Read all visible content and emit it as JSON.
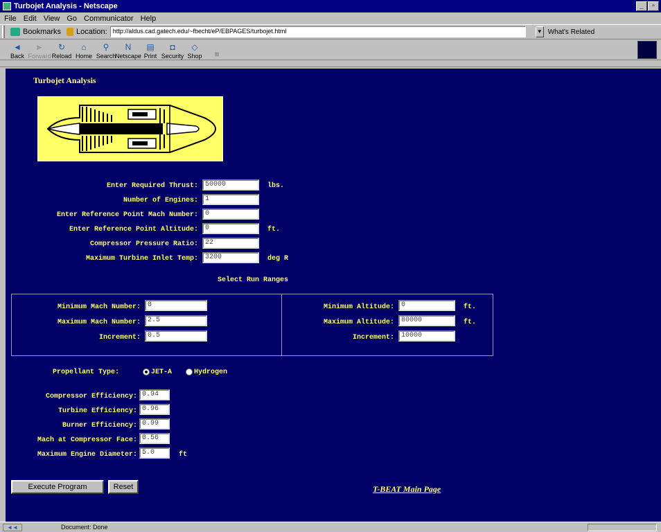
{
  "window": {
    "title": "Turbojet Analysis - Netscape"
  },
  "menu": [
    "File",
    "Edit",
    "View",
    "Go",
    "Communicator",
    "Help"
  ],
  "location_bar": {
    "bookmarks_label": "Bookmarks",
    "location_label": "Location:",
    "url": "http://aldus.cad.gatech.edu/~fbecht/eP/EBPAGES/turbojet.html",
    "related_label": "What's Related"
  },
  "toolbar": [
    {
      "label": "Back",
      "icon": "back-arrow-icon",
      "glyph": "◄"
    },
    {
      "label": "Forward",
      "icon": "forward-arrow-icon",
      "glyph": "►"
    },
    {
      "label": "Reload",
      "icon": "reload-icon",
      "glyph": "↻"
    },
    {
      "label": "Home",
      "icon": "home-icon",
      "glyph": "⌂"
    },
    {
      "label": "Search",
      "icon": "search-icon",
      "glyph": "⚲"
    },
    {
      "label": "Netscape",
      "icon": "netscape-icon",
      "glyph": "N"
    },
    {
      "label": "Print",
      "icon": "print-icon",
      "glyph": "▤"
    },
    {
      "label": "Security",
      "icon": "lock-icon",
      "glyph": "🔒"
    },
    {
      "label": "Shop",
      "icon": "shop-icon",
      "glyph": "◇"
    },
    {
      "label": "Stop",
      "icon": "stop-icon",
      "glyph": "■"
    }
  ],
  "page": {
    "heading": "Turbojet Analysis",
    "engine_image": "turbojet-engine-diagram",
    "inputs": {
      "thrust": {
        "label": "Enter Required Thrust:",
        "value": "50000",
        "unit": "lbs."
      },
      "engines": {
        "label": "Number of Engines:",
        "value": "1"
      },
      "ref_mach": {
        "label": "Enter Reference Point Mach Number:",
        "value": "0"
      },
      "ref_alt": {
        "label": "Enter Reference Point Altitude:",
        "value": "0",
        "unit": "ft."
      },
      "cpr": {
        "label": "Compressor Pressure Ratio:",
        "value": "22"
      },
      "tit": {
        "label": "Maximum Turbine Inlet Temp:",
        "value": "3200",
        "unit": "deg R"
      }
    },
    "ranges_heading": "Select Run Ranges",
    "ranges": {
      "min_mach": {
        "label": "Minimum Mach Number:",
        "value": "0"
      },
      "max_mach": {
        "label": "Maximum Mach Number:",
        "value": "2.5"
      },
      "mach_inc": {
        "label": "Increment:",
        "value": "0.5"
      },
      "min_alt": {
        "label": "Minimum Altitude:",
        "value": "0",
        "unit": "ft."
      },
      "max_alt": {
        "label": "Maximum Altitude:",
        "value": "80000",
        "unit": "ft."
      },
      "alt_inc": {
        "label": "Increment:",
        "value": "10000"
      }
    },
    "propellant": {
      "label": "Propellant Type:",
      "options": [
        "JET-A",
        "Hydrogen"
      ],
      "selected": "JET-A"
    },
    "efficiencies": {
      "compressor": {
        "label": "Compressor Efficiency:",
        "value": "0.94"
      },
      "turbine": {
        "label": "Turbine Efficiency:",
        "value": "0.96"
      },
      "burner": {
        "label": "Burner Efficiency:",
        "value": "0.99"
      },
      "mach_face": {
        "label": "Mach at Compressor Face:",
        "value": "0.56"
      },
      "diameter": {
        "label": "Maximum Engine Diameter:",
        "value": "5.0",
        "unit": "ft"
      }
    },
    "buttons": {
      "execute": "Execute Program",
      "reset": "Reset"
    },
    "main_link": "T-BEAT Main Page"
  },
  "status": {
    "text": "Document: Done"
  },
  "colors": {
    "page_bg": "#000066",
    "text": "#ffff66",
    "chrome": "#c0c0c0",
    "titlebar": "#000080"
  }
}
